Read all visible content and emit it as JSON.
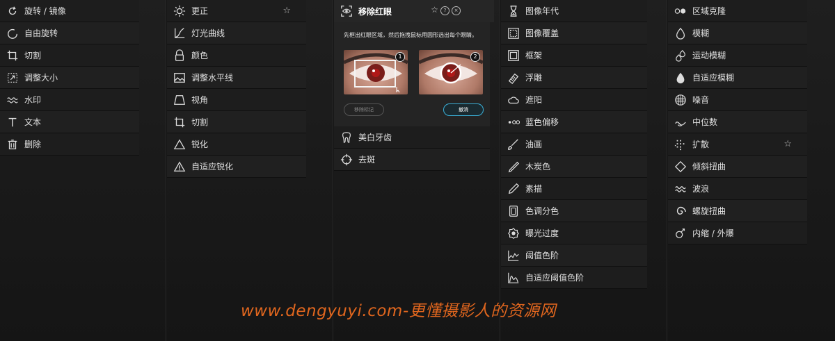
{
  "panel1": {
    "items": [
      {
        "label": "旋转 / 镜像",
        "icon": "rotate-icon"
      },
      {
        "label": "自由旋转",
        "icon": "free-rotate-icon"
      },
      {
        "label": "切割",
        "icon": "crop-icon"
      },
      {
        "label": "调整大小",
        "icon": "resize-icon"
      },
      {
        "label": "水印",
        "icon": "watermark-icon"
      },
      {
        "label": "文本",
        "icon": "text-icon"
      },
      {
        "label": "删除",
        "icon": "delete-icon"
      }
    ]
  },
  "panel2": {
    "items": [
      {
        "label": "更正",
        "icon": "brightness-icon",
        "starred": true
      },
      {
        "label": "灯光曲线",
        "icon": "curves-icon"
      },
      {
        "label": "颜色",
        "icon": "color-icon"
      },
      {
        "label": "调整水平线",
        "icon": "horizon-icon"
      },
      {
        "label": "视角",
        "icon": "perspective-icon"
      },
      {
        "label": "切割",
        "icon": "crop-icon"
      },
      {
        "label": "锐化",
        "icon": "sharpen-icon"
      },
      {
        "label": "自适应锐化",
        "icon": "adaptive-sharpen-icon"
      }
    ]
  },
  "panel3": {
    "header": {
      "label": "移除红眼",
      "icon": "redeye-icon"
    },
    "instruction": "先框出红眼区域，然后拖拽鼠标用圆形选出每个眼睛。",
    "thumb1_num": "1",
    "thumb2_num": "2",
    "remove_marks_label": "移除标记",
    "cancel_label": "撤消",
    "items": [
      {
        "label": "美白牙齿",
        "icon": "tooth-icon"
      },
      {
        "label": "去斑",
        "icon": "blemish-icon"
      }
    ]
  },
  "panel4": {
    "items": [
      {
        "label": "图像年代",
        "icon": "hourglass-icon"
      },
      {
        "label": "图像覆盖",
        "icon": "overlay-icon"
      },
      {
        "label": "框架",
        "icon": "frame-icon"
      },
      {
        "label": "浮雕",
        "icon": "emboss-icon"
      },
      {
        "label": "遮阳",
        "icon": "cloud-icon"
      },
      {
        "label": "蓝色偏移",
        "icon": "blue-shift-icon"
      },
      {
        "label": "油画",
        "icon": "brush-icon"
      },
      {
        "label": "木炭色",
        "icon": "charcoal-icon"
      },
      {
        "label": "素描",
        "icon": "pencil-icon"
      },
      {
        "label": "色调分色",
        "icon": "posterize-icon"
      },
      {
        "label": "曝光过度",
        "icon": "solarize-icon"
      },
      {
        "label": "阈值色阶",
        "icon": "threshold-icon"
      },
      {
        "label": "自适应阈值色阶",
        "icon": "adaptive-threshold-icon"
      }
    ]
  },
  "panel5": {
    "items": [
      {
        "label": "区域克隆",
        "icon": "clone-icon"
      },
      {
        "label": "模糊",
        "icon": "blur-icon"
      },
      {
        "label": "运动模糊",
        "icon": "motion-blur-icon"
      },
      {
        "label": "自适应模糊",
        "icon": "adaptive-blur-icon"
      },
      {
        "label": "噪音",
        "icon": "noise-icon"
      },
      {
        "label": "中位数",
        "icon": "median-icon"
      },
      {
        "label": "扩散",
        "icon": "diffuse-icon",
        "starred": true
      },
      {
        "label": "倾斜扭曲",
        "icon": "skew-icon"
      },
      {
        "label": "波浪",
        "icon": "wave-icon"
      },
      {
        "label": "螺旋扭曲",
        "icon": "swirl-icon"
      },
      {
        "label": "内缩 / 外爆",
        "icon": "pinch-icon"
      }
    ]
  },
  "star_glyph": "☆",
  "watermark": "www.dengyuyi.com-更懂摄影人的资源网"
}
